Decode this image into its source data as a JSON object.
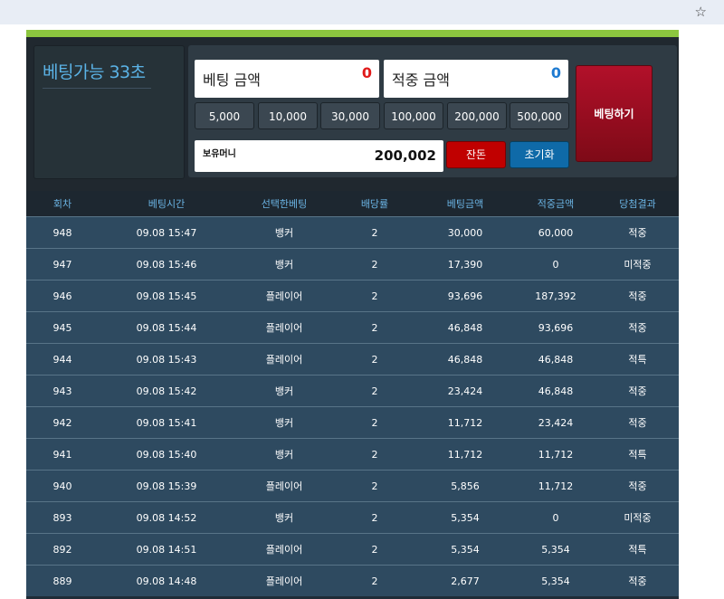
{
  "browser": {
    "bookmark_icon": "star-icon"
  },
  "timer": {
    "text": "베팅가능 33초"
  },
  "bet_amount": {
    "label": "베팅 금액",
    "value": "0",
    "value_color": "#e01b1b"
  },
  "win_amount": {
    "label": "적중 금액",
    "value": "0",
    "value_color": "#1f7bd1"
  },
  "chips": [
    "5,000",
    "10,000",
    "30,000",
    "100,000",
    "200,000",
    "500,000"
  ],
  "balance": {
    "label": "보유머니",
    "value": "200,002"
  },
  "buttons": {
    "remain": "잔돈",
    "reset": "초기화",
    "bet": "베팅하기"
  },
  "colors": {
    "accent_green": "#8cc63f",
    "win": "#2d8a2d",
    "lose": "#c0141a",
    "special": "#e8a020"
  },
  "table": {
    "headers": [
      "회차",
      "베팅시간",
      "선택한베팅",
      "배당률",
      "베팅금액",
      "적중금액",
      "당첨결과"
    ],
    "rows": [
      [
        "948",
        "09.08 15:47",
        "뱅커",
        "2",
        "30,000",
        "60,000",
        "적중"
      ],
      [
        "947",
        "09.08 15:46",
        "뱅커",
        "2",
        "17,390",
        "0",
        "미적중"
      ],
      [
        "946",
        "09.08 15:45",
        "플레이어",
        "2",
        "93,696",
        "187,392",
        "적중"
      ],
      [
        "945",
        "09.08 15:44",
        "플레이어",
        "2",
        "46,848",
        "93,696",
        "적중"
      ],
      [
        "944",
        "09.08 15:43",
        "플레이어",
        "2",
        "46,848",
        "46,848",
        "적특"
      ],
      [
        "943",
        "09.08 15:42",
        "뱅커",
        "2",
        "23,424",
        "46,848",
        "적중"
      ],
      [
        "942",
        "09.08 15:41",
        "뱅커",
        "2",
        "11,712",
        "23,424",
        "적중"
      ],
      [
        "941",
        "09.08 15:40",
        "뱅커",
        "2",
        "11,712",
        "11,712",
        "적특"
      ],
      [
        "940",
        "09.08 15:39",
        "플레이어",
        "2",
        "5,856",
        "11,712",
        "적중"
      ],
      [
        "893",
        "09.08 14:52",
        "뱅커",
        "2",
        "5,354",
        "0",
        "미적중"
      ],
      [
        "892",
        "09.08 14:51",
        "플레이어",
        "2",
        "5,354",
        "5,354",
        "적특"
      ],
      [
        "889",
        "09.08 14:48",
        "플레이어",
        "2",
        "2,677",
        "5,354",
        "적중"
      ]
    ]
  }
}
